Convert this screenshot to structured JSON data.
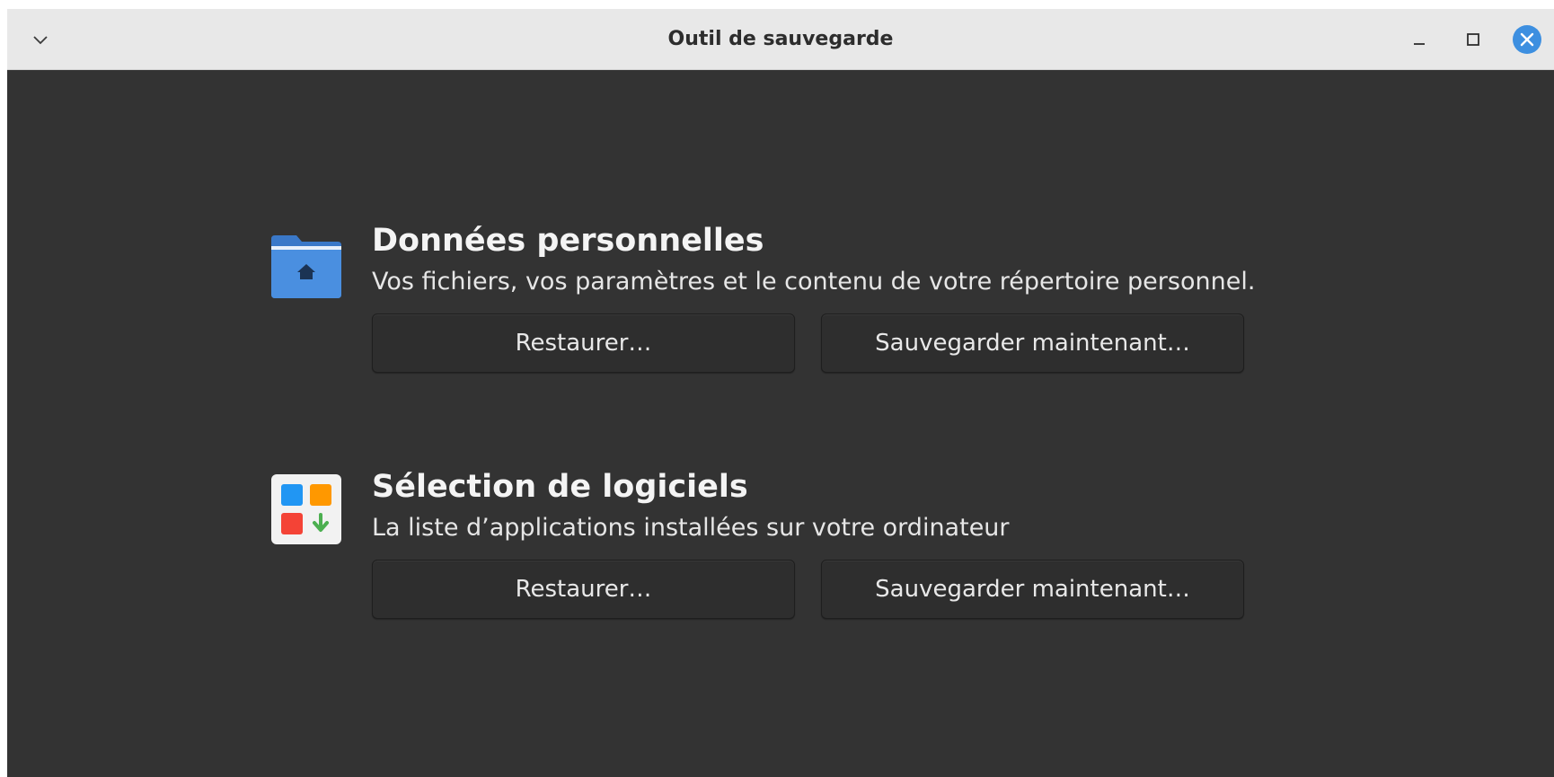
{
  "window": {
    "title": "Outil de sauvegarde"
  },
  "titlebar_icons": {
    "menu": "chevron-down-icon",
    "minimize": "minimize-icon",
    "maximize": "maximize-icon",
    "close": "close-icon",
    "close_color": "#3d8fe0"
  },
  "sections": [
    {
      "icon": "home-folder-icon",
      "title": "Données personnelles",
      "description": "Vos fichiers, vos paramètres et le contenu de votre répertoire personnel.",
      "restore_label": "Restaurer…",
      "backup_label": "Sauvegarder maintenant…"
    },
    {
      "icon": "software-selection-icon",
      "title": "Sélection de logiciels",
      "description": "La liste d’applications installées sur votre ordinateur",
      "restore_label": "Restaurer…",
      "backup_label": "Sauvegarder maintenant…"
    }
  ],
  "colors": {
    "background": "#333333",
    "titlebar": "#e8e8e8",
    "folder_blue": "#4a8fe0",
    "tile_blue": "#2196f3",
    "tile_orange": "#ff9800",
    "tile_red": "#f44336",
    "arrow_green": "#4caf50"
  }
}
